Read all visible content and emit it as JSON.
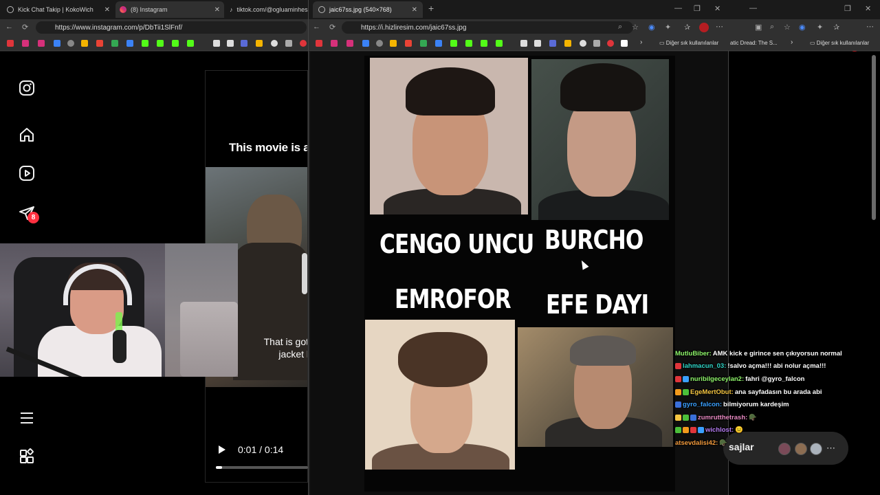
{
  "background_browser": {
    "tabs": [
      {
        "label": "Kick Chat Takip | KokoWich",
        "active": false
      },
      {
        "label": "(8) Instagram",
        "active": true
      },
      {
        "label": "tiktok.com/@ogluaminhesap",
        "active": false
      }
    ],
    "url": "https://www.instagram.com/p/DbTii1SlFnf/",
    "bookmarks_right": [
      "atic Dread: The S...",
      "Diğer sık kullanılanlar"
    ]
  },
  "instagram": {
    "sidebar_icons": [
      "instagram-logo-icon",
      "home-icon",
      "reels-icon",
      "messages-icon",
      "menu-icon",
      "apps-icon"
    ],
    "notification_badge": "8",
    "reel_caption": "This movie is a",
    "reel_subtitle_line1": "That is got",
    "reel_subtitle_line2": "jacket l",
    "player_time": "0:01 / 0:14",
    "progress": 0.07
  },
  "front_window": {
    "tab_label": "jaic67ss.jpg (540×768)",
    "url": "https://i.hizliresim.com/jaic67ss.jpg",
    "bookmarks_more": "Diğer sık kullanılanlar"
  },
  "meme": {
    "names": [
      "CENGO UNCU",
      "BURCHO",
      "EMROFOR",
      "EFE DAYI"
    ]
  },
  "chat": {
    "messages": [
      {
        "user": "MutluBiber:",
        "msg": "AMK kick e girince sen çıkıyorsun normal",
        "color": "#8ef56a",
        "icons": []
      },
      {
        "user": "lahmacun_03:",
        "msg": "!salvo açma!!! abi nolur açma!!!",
        "color": "#2fd6c8",
        "icons": [
          "#e0353b"
        ]
      },
      {
        "user": "nuribilgeceylan2:",
        "msg": "fahri @gyro_falcon",
        "color": "#8ef56a",
        "icons": [
          "#e0353b",
          "#3aa0ff"
        ]
      },
      {
        "user": "EgeMertObut:",
        "msg": "ana sayfadasın bu arada abi",
        "color": "#f4c542",
        "icons": [
          "#f29a1c",
          "#4bbf3a"
        ]
      },
      {
        "user": "gyro_falcon:",
        "msg": "bilmiyorum kardeşim",
        "color": "#3aa0ff",
        "icons": [
          "#3a6fd9"
        ]
      },
      {
        "user": "zumrutthetrash:",
        "msg": "🪖",
        "color": "#e889c2",
        "icons": [
          "#f4c542",
          "#4bbf3a",
          "#3a6fd9"
        ]
      },
      {
        "user": "wichlost:",
        "msg": "😐",
        "color": "#b57cf2",
        "icons": [
          "#4bbf3a",
          "#f29a1c",
          "#e0353b",
          "#3aa0ff"
        ]
      },
      {
        "user": "atsevdalisi42:",
        "msg": "🪖",
        "color": "#f29a3c",
        "icons": []
      }
    ],
    "pill_label": "sajlar"
  }
}
